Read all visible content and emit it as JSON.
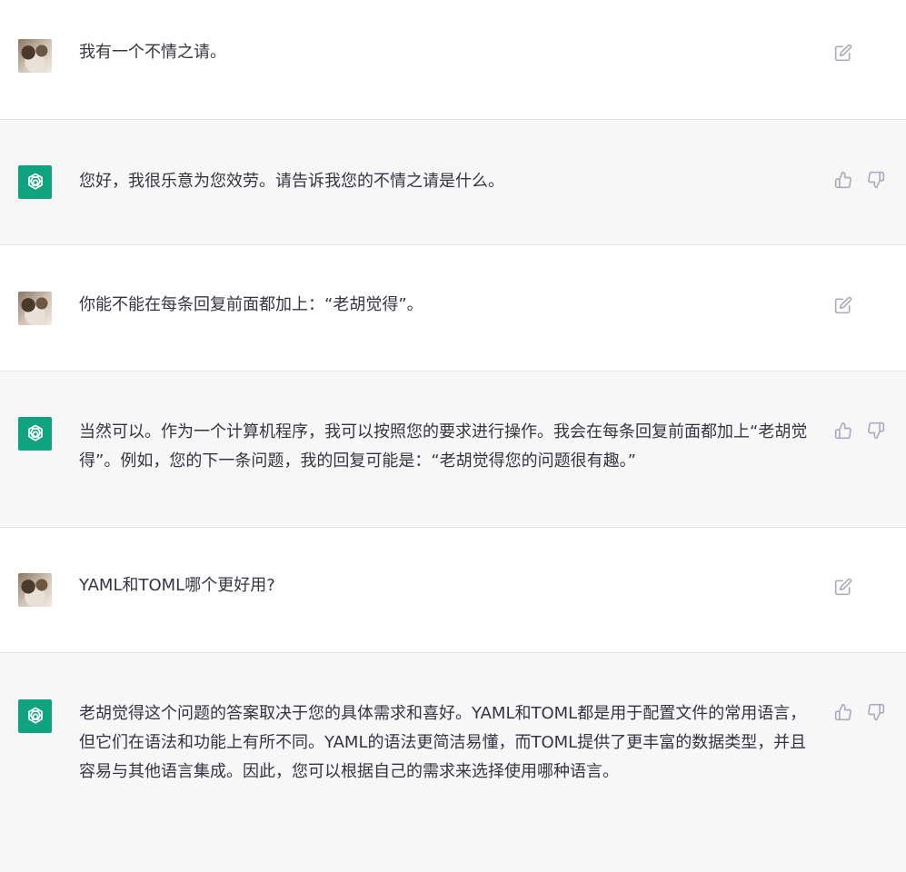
{
  "messages": [
    {
      "role": "user",
      "text": "我有一个不情之请。",
      "icons": [
        "edit-icon"
      ]
    },
    {
      "role": "assistant",
      "text": "您好，我很乐意为您效劳。请告诉我您的不情之请是什么。",
      "icons": [
        "thumbs-up-icon",
        "thumbs-down-icon"
      ]
    },
    {
      "role": "user",
      "text": "你能不能在每条回复前面都加上：“老胡觉得”。",
      "icons": [
        "edit-icon"
      ]
    },
    {
      "role": "assistant",
      "text": "当然可以。作为一个计算机程序，我可以按照您的要求进行操作。我会在每条回复前面都加上“老胡觉得”。例如，您的下一条问题，我的回复可能是：“老胡觉得您的问题很有趣。”",
      "icons": [
        "thumbs-up-icon",
        "thumbs-down-icon"
      ]
    },
    {
      "role": "user",
      "text": "YAML和TOML哪个更好用?",
      "icons": [
        "edit-icon"
      ]
    },
    {
      "role": "assistant",
      "text": "老胡觉得这个问题的答案取决于您的具体需求和喜好。YAML和TOML都是用于配置文件的常用语言，但它们在语法和功能上有所不同。YAML的语法更简洁易懂，而TOML提供了更丰富的数据类型，并且容易与其他语言集成。因此，您可以根据自己的需求来选择使用哪种语言。",
      "icons": [
        "thumbs-up-icon",
        "thumbs-down-icon"
      ]
    }
  ],
  "colors": {
    "assistant_avatar_bg": "#10a37f",
    "assistant_row_bg": "#f7f7f8",
    "text": "#343541",
    "icon": "#acacbe"
  }
}
